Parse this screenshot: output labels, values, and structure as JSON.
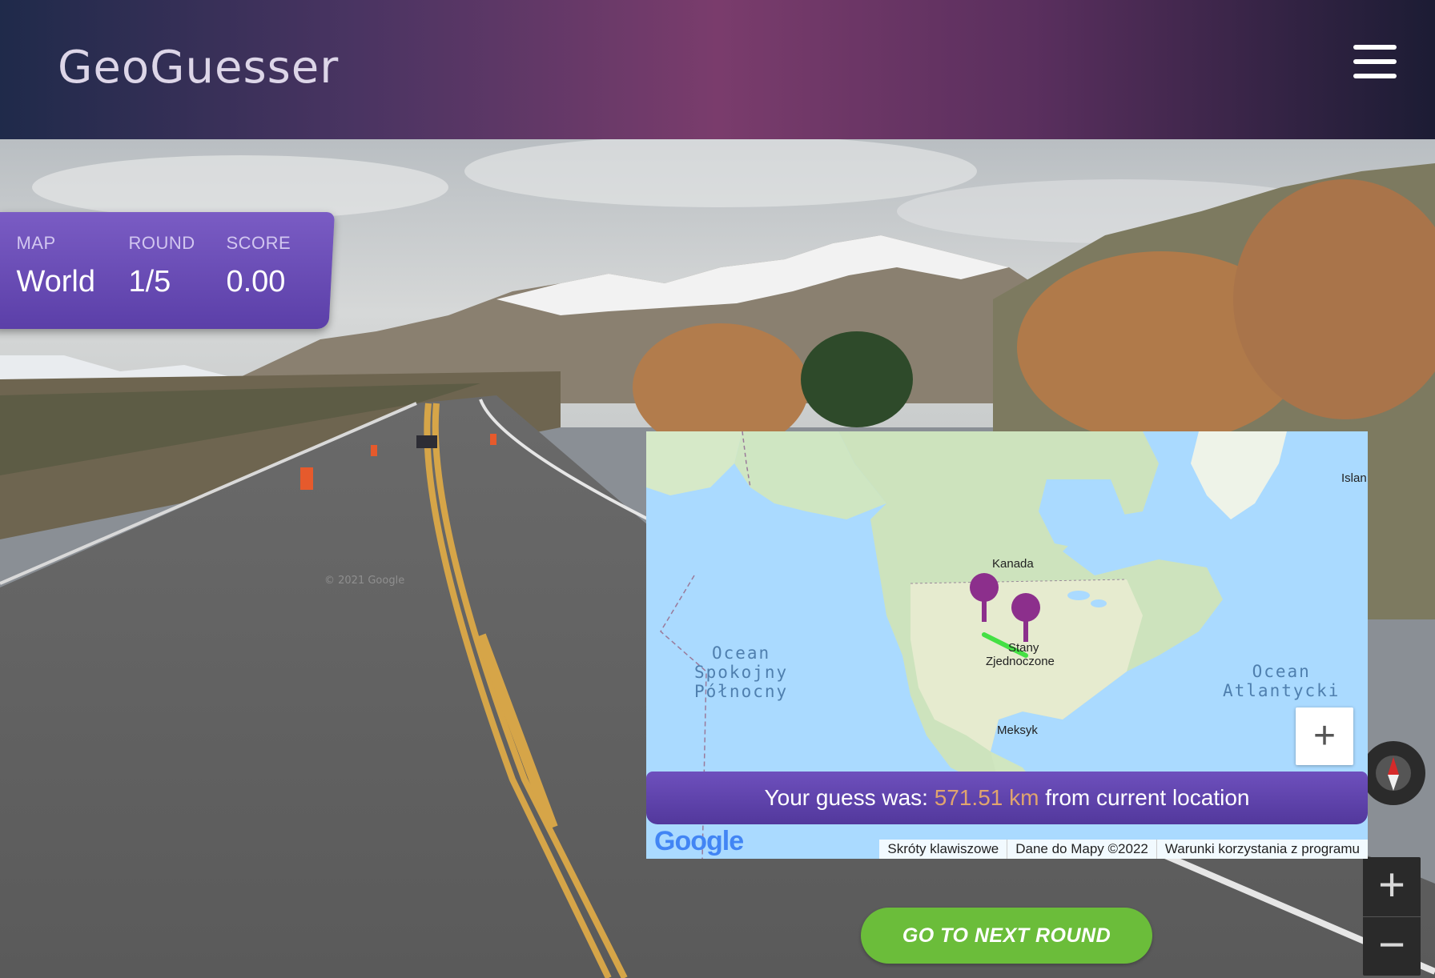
{
  "header": {
    "logo": "GeoGuesser",
    "menu_icon": "hamburger-menu-icon"
  },
  "stats": [
    {
      "label": "MAP",
      "value": "World"
    },
    {
      "label": "ROUND",
      "value": "1/5"
    },
    {
      "label": "SCORE",
      "value": "0.00"
    }
  ],
  "map": {
    "labels": {
      "canada": "Kanada",
      "usa_line1": "Stany",
      "usa_line2": "Zjednoczone",
      "mexico": "Meksyk",
      "island": "Islan"
    },
    "oceans": {
      "pacific": [
        "Ocean",
        "Spokojny",
        "Północny"
      ],
      "atlantic": [
        "Ocean",
        "Atlantycki"
      ]
    },
    "zoom_in": "+",
    "result_prefix": "Your guess was:",
    "result_distance": "571.51 km",
    "result_suffix": "from current location",
    "google": "Google",
    "attribution": [
      "Skróty klawiszowe",
      "Dane do Mapy ©2022",
      "Warunki korzystania z programu"
    ]
  },
  "next_round": "GO TO NEXT ROUND",
  "streetview": {
    "zoom_in": "+",
    "zoom_out": "−",
    "watermark": "© 2021 Google"
  },
  "colors": {
    "accent": "#5b3fa8",
    "next": "#6bbd3a",
    "distance": "#e0a46e",
    "pin": "#8c2f8c",
    "line": "#44e044"
  }
}
